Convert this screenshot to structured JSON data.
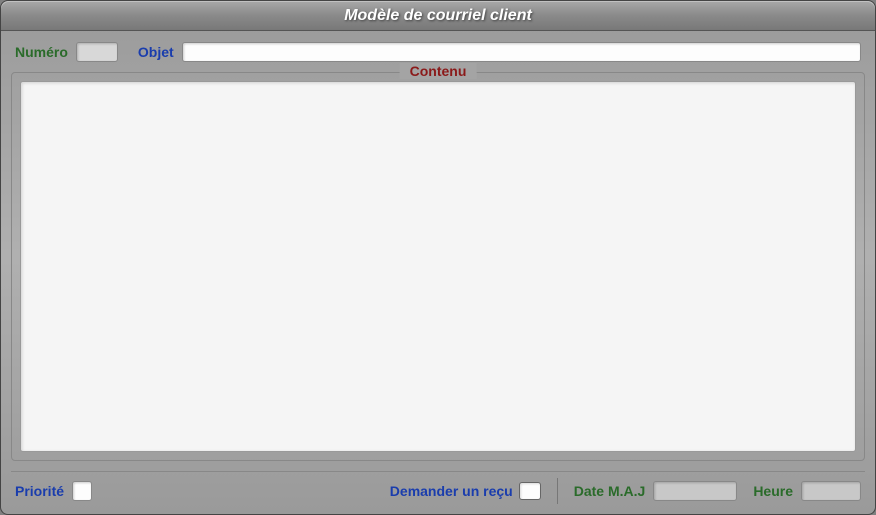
{
  "window": {
    "title": "Modèle de courriel client"
  },
  "top": {
    "numero_label": "Numéro",
    "numero_value": "",
    "objet_label": "Objet",
    "objet_value": ""
  },
  "fieldset": {
    "legend": "Contenu",
    "content_value": ""
  },
  "bottom": {
    "priorite_label": "Priorité",
    "priorite_value": "",
    "recu_label": "Demander un reçu",
    "recu_checked": false,
    "date_label": "Date M.A.J",
    "date_value": "",
    "heure_label": "Heure",
    "heure_value": ""
  }
}
